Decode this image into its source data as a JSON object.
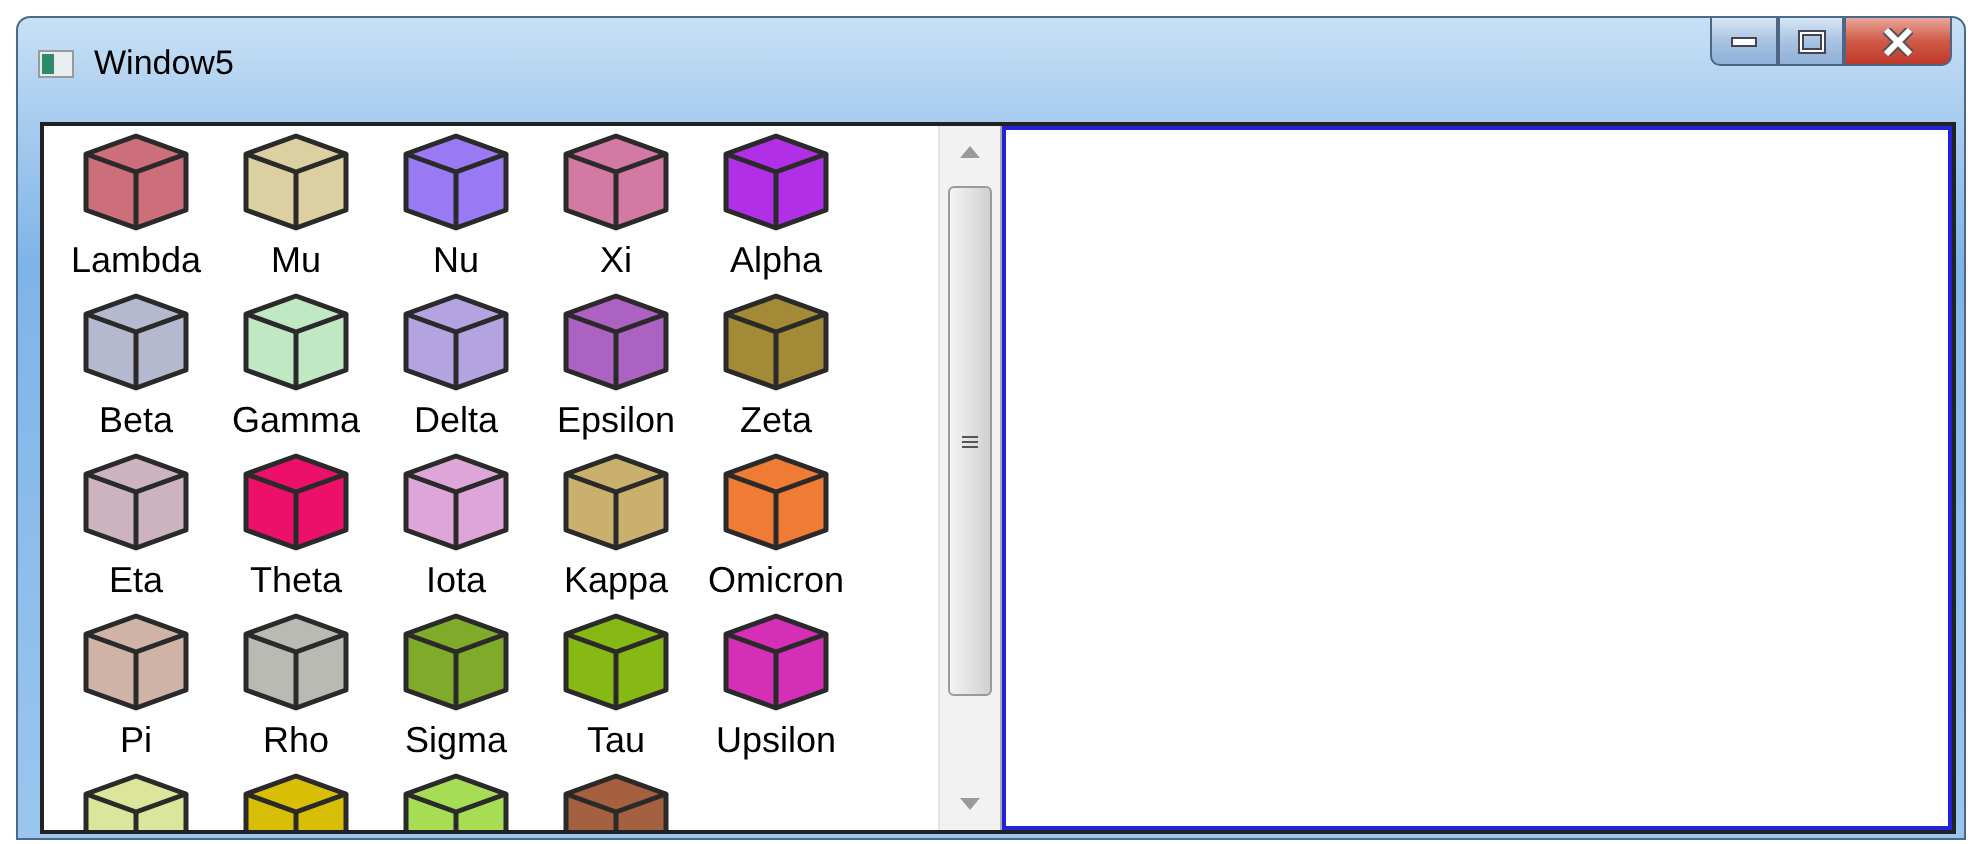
{
  "window": {
    "title": "Window5"
  },
  "items": [
    {
      "name": "Lambda",
      "color": "#cc6f7a"
    },
    {
      "name": "Mu",
      "color": "#dccfa2"
    },
    {
      "name": "Nu",
      "color": "#9a79f5"
    },
    {
      "name": "Xi",
      "color": "#d479a4"
    },
    {
      "name": "Alpha",
      "color": "#b12fe6"
    },
    {
      "name": "Beta",
      "color": "#b4b9cf"
    },
    {
      "name": "Gamma",
      "color": "#c0e8c2"
    },
    {
      "name": "Delta",
      "color": "#b4a3e1"
    },
    {
      "name": "Epsilon",
      "color": "#ac62c0"
    },
    {
      "name": "Zeta",
      "color": "#a28a36"
    },
    {
      "name": "Eta",
      "color": "#cdb3bf"
    },
    {
      "name": "Theta",
      "color": "#ec106a"
    },
    {
      "name": "Iota",
      "color": "#dea6d8"
    },
    {
      "name": "Kappa",
      "color": "#c9b06d"
    },
    {
      "name": "Omicron",
      "color": "#ef7b35"
    },
    {
      "name": "Pi",
      "color": "#cfb3a6"
    },
    {
      "name": "Rho",
      "color": "#b8bab3"
    },
    {
      "name": "Sigma",
      "color": "#80ab2a"
    },
    {
      "name": "Tau",
      "color": "#86b913"
    },
    {
      "name": "Upsilon",
      "color": "#d52fb8"
    },
    {
      "color": "#dce59c"
    },
    {
      "color": "#d8bf06"
    },
    {
      "color": "#a6dd54"
    },
    {
      "color": "#a5603f"
    }
  ]
}
